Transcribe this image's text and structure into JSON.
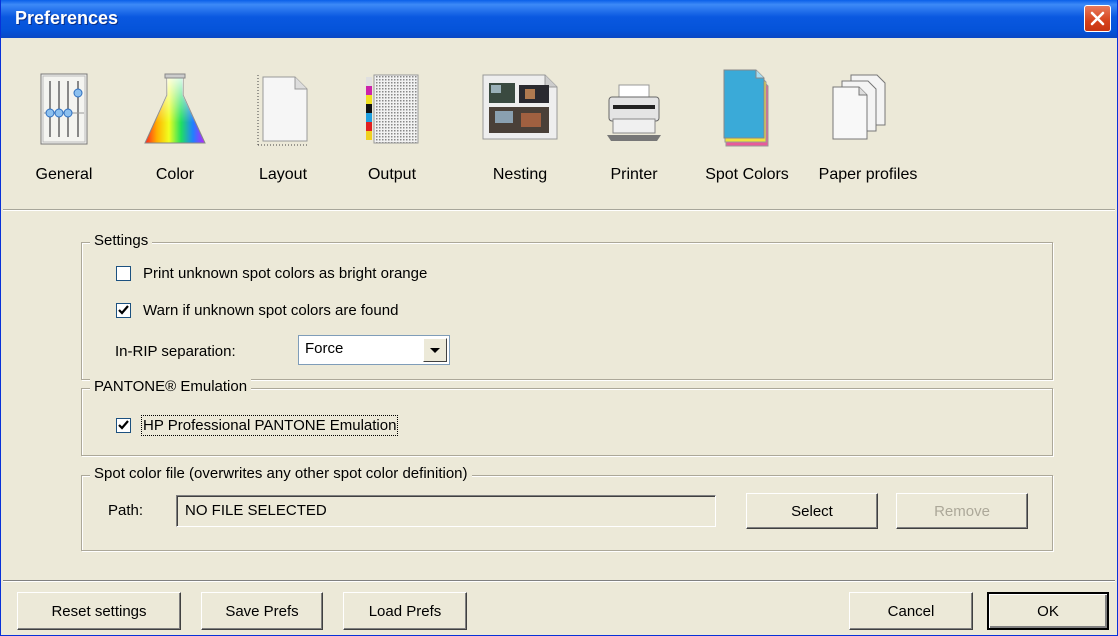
{
  "window": {
    "title": "Preferences"
  },
  "toolbar": {
    "items": [
      {
        "label": "General",
        "icon": "sliders-icon"
      },
      {
        "label": "Color",
        "icon": "color-flask-icon"
      },
      {
        "label": "Layout",
        "icon": "page-icon"
      },
      {
        "label": "Output",
        "icon": "output-sheet-icon"
      },
      {
        "label": "Nesting",
        "icon": "nesting-images-icon"
      },
      {
        "label": "Printer",
        "icon": "printer-icon"
      },
      {
        "label": "Spot Colors",
        "icon": "spot-colors-icon"
      },
      {
        "label": "Paper profiles",
        "icon": "paper-stack-icon"
      }
    ]
  },
  "settings": {
    "legend": "Settings",
    "print_unknown_label": "Print unknown spot colors as bright orange",
    "print_unknown_checked": false,
    "warn_unknown_label": "Warn if unknown spot colors are found",
    "warn_unknown_checked": true,
    "inrip_label": "In-RIP separation:",
    "inrip_value": "Force"
  },
  "pantone": {
    "legend": "PANTONE® Emulation",
    "hp_label": "HP Professional PANTONE Emulation",
    "hp_checked": true
  },
  "spotfile": {
    "legend": "Spot color file (overwrites any other spot color definition)",
    "path_label": "Path:",
    "path_value": "NO FILE SELECTED",
    "select_label": "Select",
    "remove_label": "Remove"
  },
  "footer": {
    "reset_label": "Reset settings",
    "save_label": "Save Prefs",
    "load_label": "Load Prefs",
    "cancel_label": "Cancel",
    "ok_label": "OK"
  },
  "colors": {
    "titlebar": "#0a58e0",
    "close": "#d6421b",
    "dialog": "#ece9d8"
  }
}
